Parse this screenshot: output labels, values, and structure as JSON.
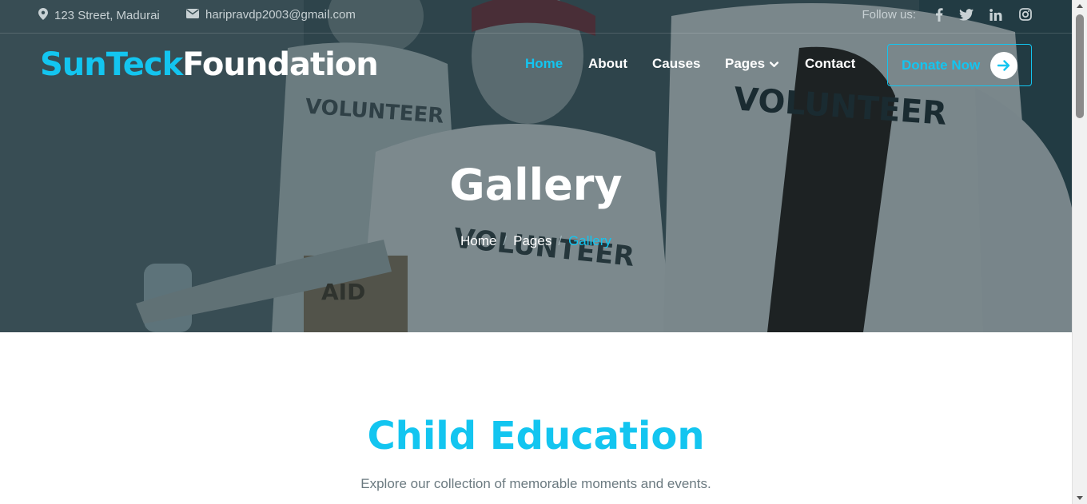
{
  "topbar": {
    "address": "123 Street, Madurai",
    "email": "haripravdp2003@gmail.com",
    "follow_label": "Follow us:",
    "social": [
      "facebook-icon",
      "twitter-icon",
      "linkedin-icon",
      "instagram-icon"
    ]
  },
  "brand": {
    "part1": "SunTeck",
    "part2": "Foundation"
  },
  "nav": {
    "home": "Home",
    "about": "About",
    "causes": "Causes",
    "pages": "Pages",
    "contact": "Contact",
    "donate": "Donate Now"
  },
  "hero": {
    "title": "Gallery",
    "breadcrumb": {
      "home": "Home",
      "pages": "Pages",
      "current": "Gallery"
    },
    "shirt_text": [
      "VOLUNTEER",
      "VOLUNTEER",
      "VOLUNTEER",
      "AID"
    ]
  },
  "section": {
    "title": "Child Education",
    "subtitle": "Explore our collection of memorable moments and events."
  },
  "colors": {
    "accent": "#13c5f0",
    "overlay": "#0e2228",
    "subtitle": "#6b7a80"
  }
}
